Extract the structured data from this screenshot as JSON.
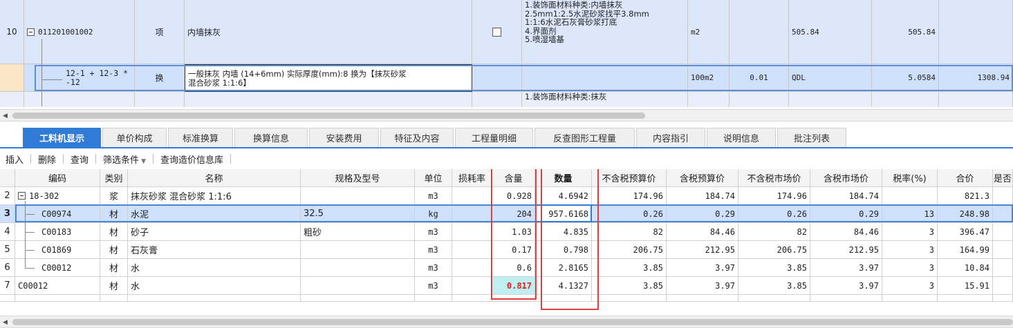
{
  "upper_rows": [
    {
      "num": "10",
      "code": "011201001002",
      "type": "项",
      "name": "内墙抹灰",
      "feature_lines": "1.装饰面材料种类:内墙抹灰\n2.5mm1:2.5水泥砂浆找平3.8mm\n1:1:6水泥石灰膏砂浆打底\n4.界面剂\n5.喷湿墙基",
      "unit": "m2",
      "qty_expr": "",
      "qty": "505.84",
      "qty2": "505.84",
      "price": ""
    },
    {
      "num": "",
      "code": "12-1 + 12-3 *\n-12",
      "type": "换",
      "name": "一般抹灰 内墙 (14+6mm) 实际厚度(mm):8 换为【抹灰砂浆\n混合砂浆 1:1:6】",
      "unit": "100m2",
      "qty_expr": "0.01",
      "code_ref": "QDL",
      "qty2": "5.0584",
      "price": "1308.94"
    },
    {
      "feature_lines": "1.装饰面材料种类:抹灰"
    }
  ],
  "tabs": [
    "工料机显示",
    "单价构成",
    "标准换算",
    "换算信息",
    "安装费用",
    "特征及内容",
    "工程量明细",
    "反查图形工程量",
    "内容指引",
    "说明信息",
    "批注列表"
  ],
  "toolbar": {
    "insert": "插入",
    "delete": "删除",
    "query": "查询",
    "filter": "筛选条件",
    "price_lib": "查询造价信息库"
  },
  "lower_headers": [
    "编码",
    "类别",
    "名称",
    "规格及型号",
    "单位",
    "损耗率",
    "含量",
    "数量",
    "不含税预算价",
    "含税预算价",
    "不含税市场价",
    "含税市场价",
    "税率(%)",
    "合价",
    "是否"
  ],
  "lower_rows": [
    {
      "n": "2",
      "code": "18-302",
      "cat": "浆",
      "name": "抹灰砂浆 混合砂浆 1:1:6",
      "spec": "",
      "unit": "m3",
      "loss": "",
      "content": "0.928",
      "qty": "4.6942",
      "p1": "174.96",
      "p2": "184.74",
      "p3": "174.96",
      "p4": "184.74",
      "tax": "",
      "total": "821.3"
    },
    {
      "n": "3",
      "code": "C00974",
      "cat": "材",
      "name": "水泥",
      "spec": "32.5",
      "unit": "kg",
      "loss": "",
      "content": "204",
      "qty": "957.6168",
      "p1": "0.26",
      "p2": "0.29",
      "p3": "0.26",
      "p4": "0.29",
      "tax": "13",
      "total": "248.98"
    },
    {
      "n": "4",
      "code": "C00183",
      "cat": "材",
      "name": "砂子",
      "spec": "粗砂",
      "unit": "m3",
      "loss": "",
      "content": "1.03",
      "qty": "4.835",
      "p1": "82",
      "p2": "84.46",
      "p3": "82",
      "p4": "84.46",
      "tax": "3",
      "total": "396.47"
    },
    {
      "n": "5",
      "code": "C01869",
      "cat": "材",
      "name": "石灰膏",
      "spec": "",
      "unit": "m3",
      "loss": "",
      "content": "0.17",
      "qty": "0.798",
      "p1": "206.75",
      "p2": "212.95",
      "p3": "206.75",
      "p4": "212.95",
      "tax": "3",
      "total": "164.99"
    },
    {
      "n": "6",
      "code": "C00012",
      "cat": "材",
      "name": "水",
      "spec": "",
      "unit": "m3",
      "loss": "",
      "content": "0.6",
      "qty": "2.8165",
      "p1": "3.85",
      "p2": "3.97",
      "p3": "3.85",
      "p4": "3.97",
      "tax": "3",
      "total": "10.84"
    },
    {
      "n": "7",
      "code": "C00012",
      "cat": "材",
      "name": "水",
      "spec": "",
      "unit": "m3",
      "loss": "",
      "content": "0.817",
      "qty": "4.1327",
      "p1": "3.85",
      "p2": "3.97",
      "p3": "3.85",
      "p4": "3.97",
      "tax": "3",
      "total": "15.91"
    }
  ],
  "colors": {
    "accent": "#2f7bd6",
    "highlight_box": "#e33c3c",
    "selected_row": "#cfe0fb"
  }
}
